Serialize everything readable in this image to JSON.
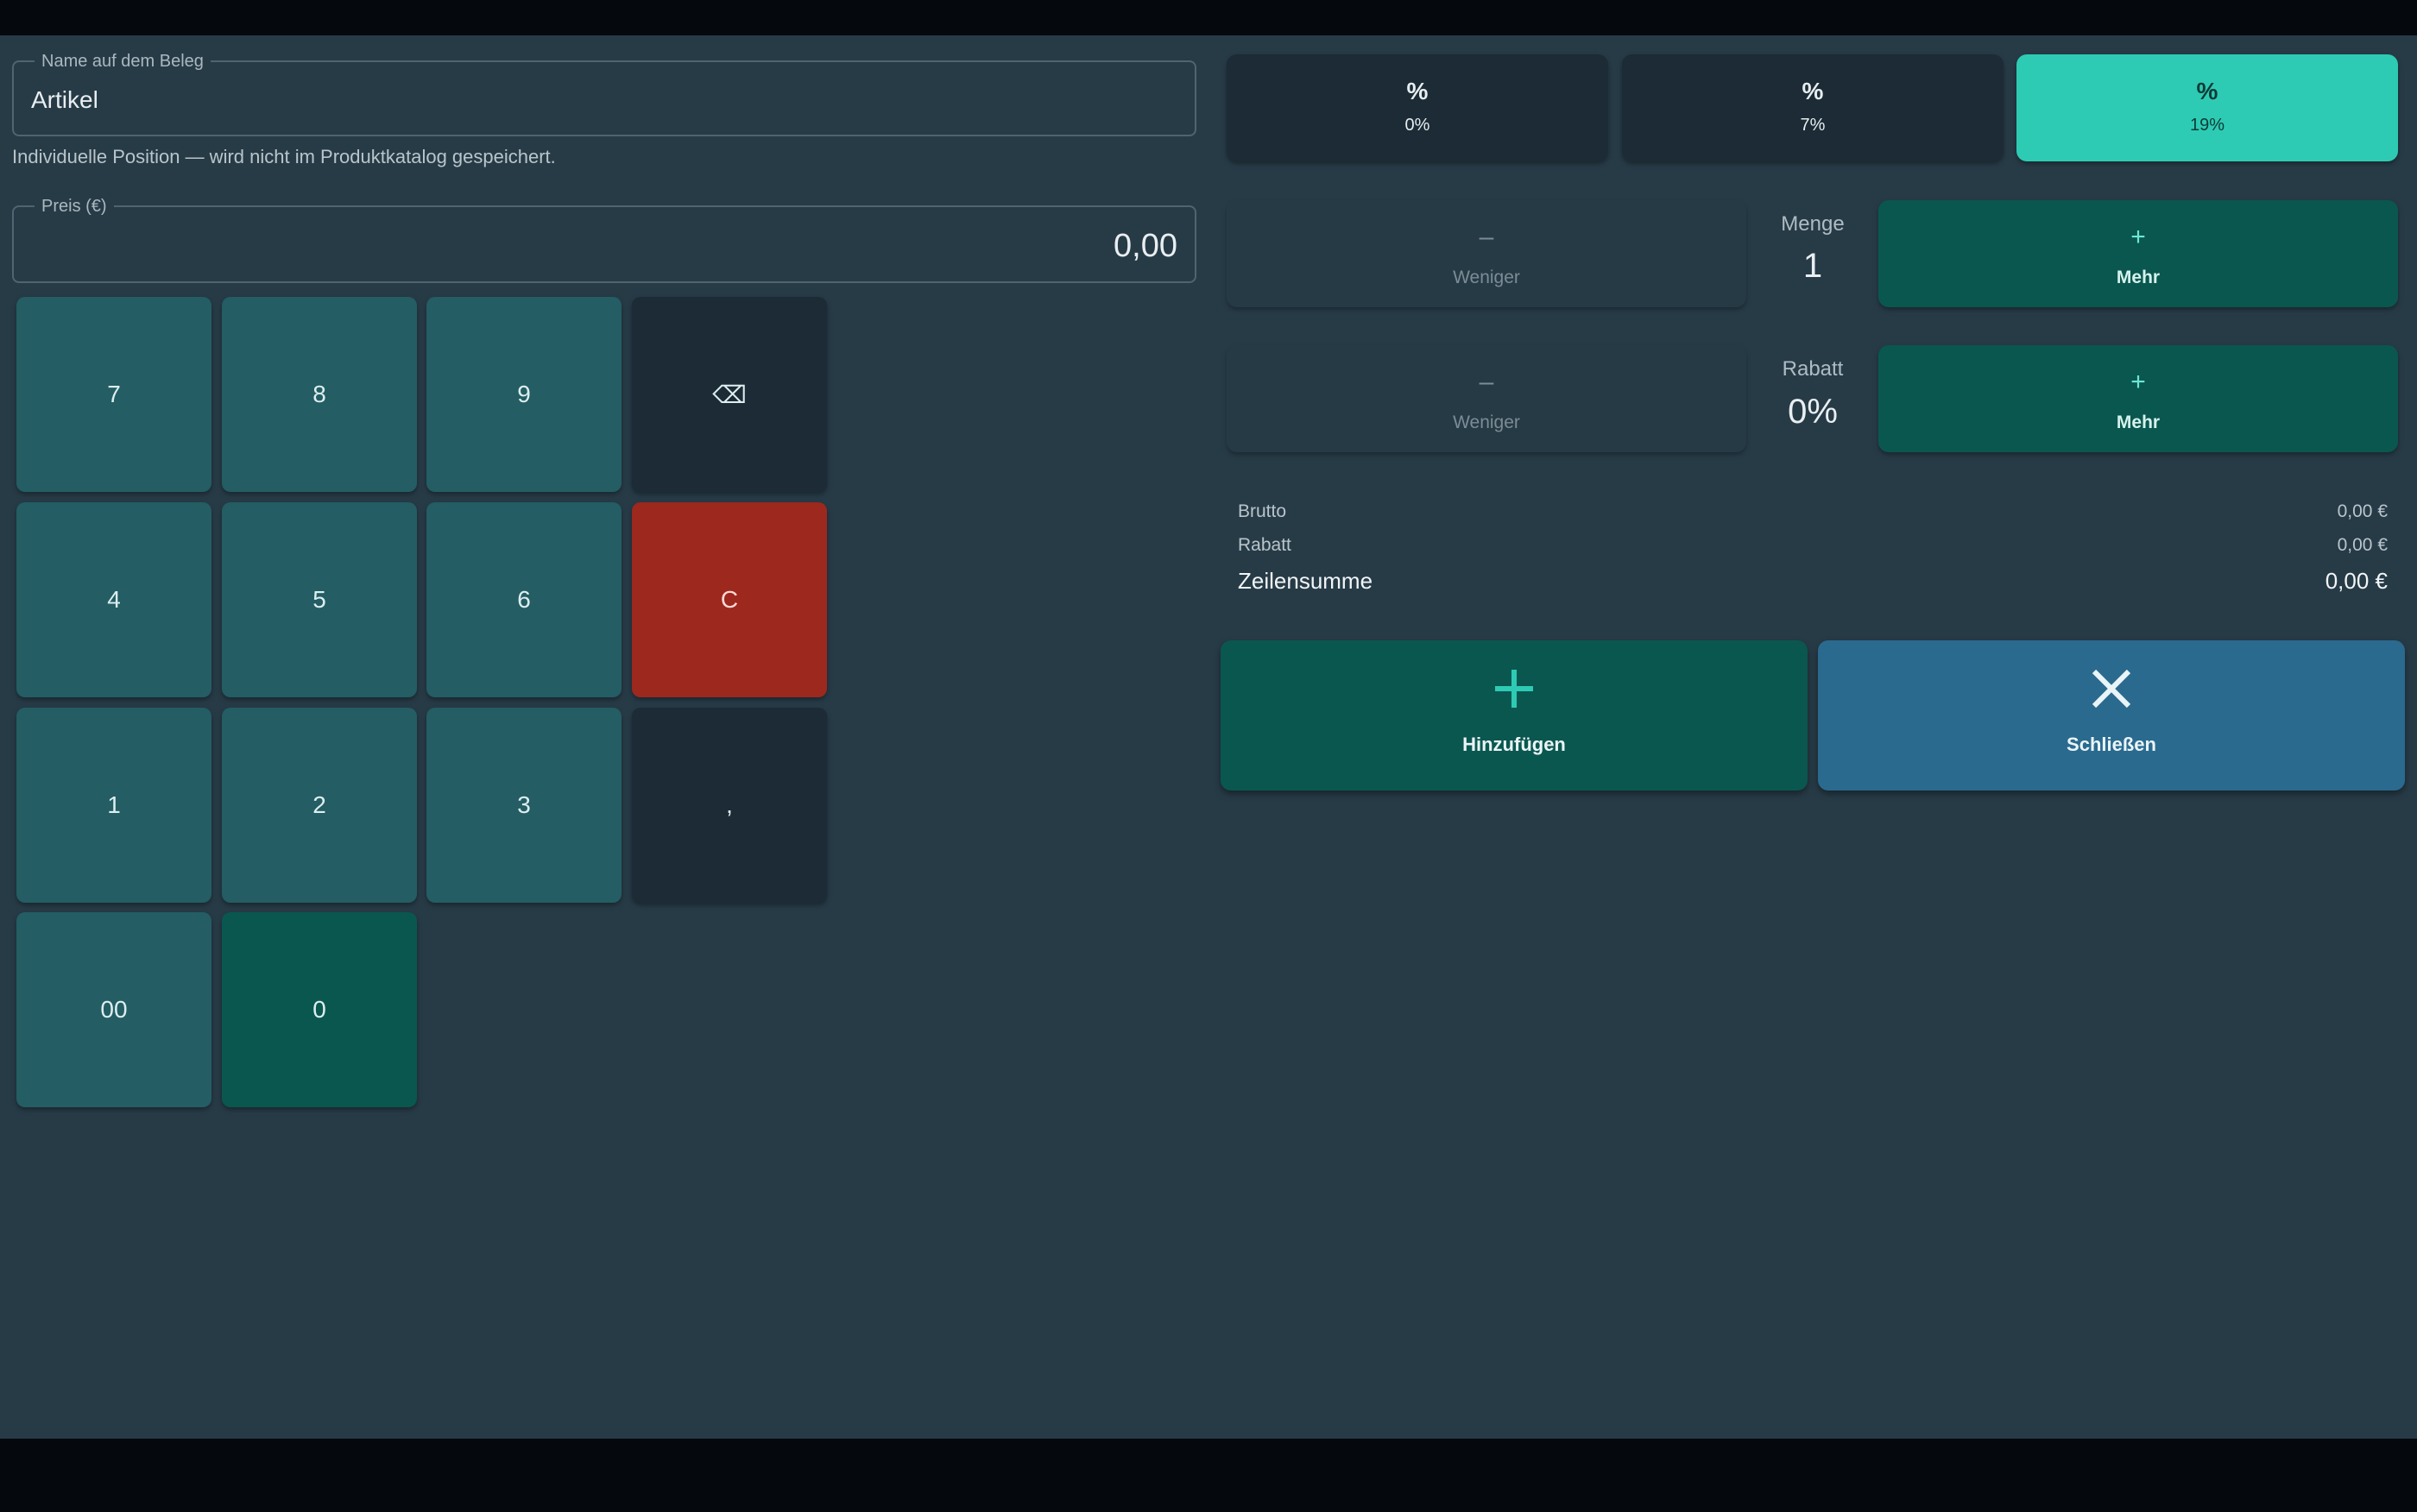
{
  "receipt_name": {
    "label": "Name auf dem Beleg",
    "value": "Artikel"
  },
  "helper_text": "Individuelle Position — wird nicht im Produktkatalog gespeichert.",
  "price": {
    "label": "Preis (€)",
    "value": "0,00"
  },
  "keypad": {
    "k7": "7",
    "k8": "8",
    "k9": "9",
    "backspace": "⌫",
    "k4": "4",
    "k5": "5",
    "k6": "6",
    "clear": "C",
    "k1": "1",
    "k2": "2",
    "k3": "3",
    "comma": ",",
    "k00": "00",
    "k0": "0"
  },
  "tax": {
    "icon": "percent-icon",
    "options": [
      "0%",
      "7%",
      "19%"
    ],
    "selected": "19%"
  },
  "quantity": {
    "title": "Menge",
    "value": "1",
    "less": "Weniger",
    "more": "Mehr"
  },
  "discount": {
    "title": "Rabatt",
    "value": "0%",
    "less": "Weniger",
    "more": "Mehr"
  },
  "summary": {
    "gross_label": "Brutto",
    "gross_value": "0,00 €",
    "discount_label": "Rabatt",
    "discount_value": "0,00 €",
    "total_label": "Zeilensumme",
    "total_value": "0,00 €"
  },
  "actions": {
    "add": "Hinzufügen",
    "close": "Schließen"
  },
  "colors": {
    "accent": "#2ecbb4",
    "primary_dark": "#0a5750",
    "clear_red": "#9c281e",
    "close_blue": "#2a6a8f",
    "background": "#273b47"
  }
}
